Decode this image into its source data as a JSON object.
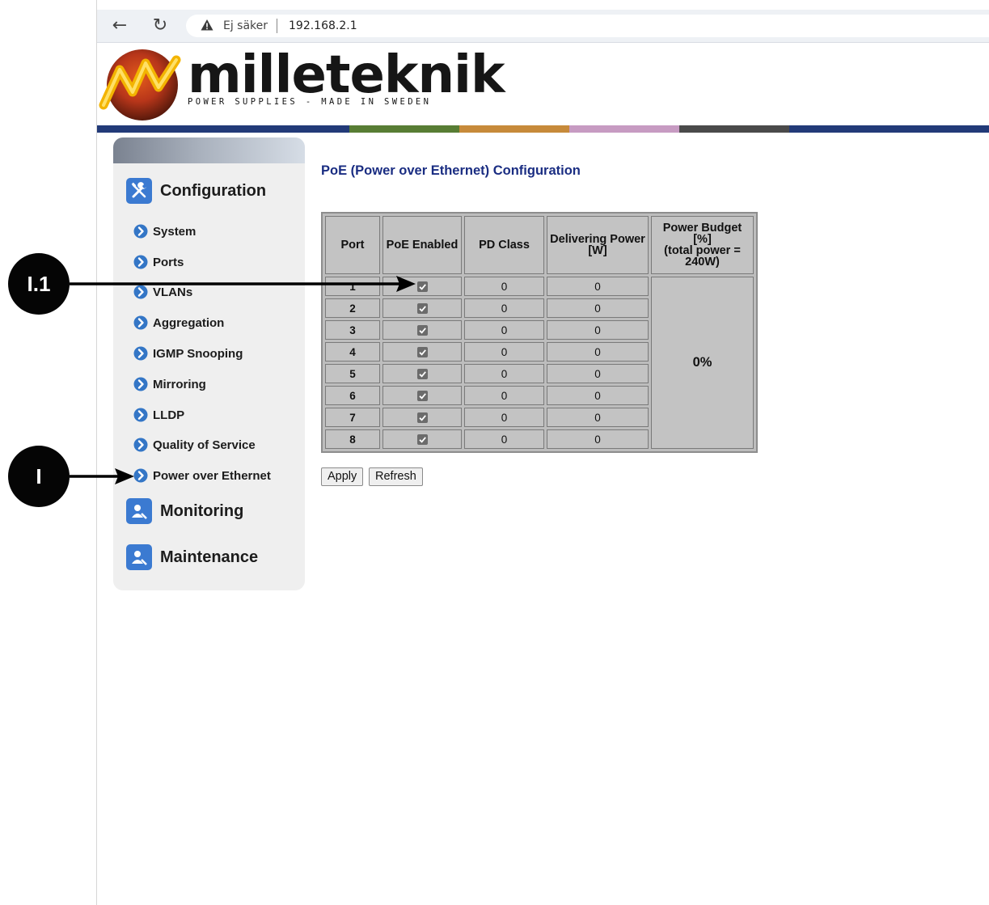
{
  "browser": {
    "security_label": "Ej säker",
    "url": "192.168.2.1"
  },
  "logo": {
    "wordmark": "milleteknik",
    "tagline": "POWER SUPPLIES - MADE IN SWEDEN"
  },
  "colors": {
    "strip": [
      "#223a78",
      "#587d34",
      "#c78a3a",
      "#c79bc2",
      "#4a4a4a",
      "#223a78"
    ],
    "title": "#1a2d82",
    "icon_blue": "#3b7ad1"
  },
  "sidebar": {
    "configuration": "Configuration",
    "items": [
      {
        "label": "System",
        "icon": "chevron-right-icon"
      },
      {
        "label": "Ports",
        "icon": "chevron-right-icon"
      },
      {
        "label": "VLANs",
        "icon": "chevron-right-icon"
      },
      {
        "label": "Aggregation",
        "icon": "chevron-right-icon"
      },
      {
        "label": "IGMP Snooping",
        "icon": "chevron-right-icon"
      },
      {
        "label": "Mirroring",
        "icon": "chevron-right-icon"
      },
      {
        "label": "LLDP",
        "icon": "chevron-right-icon"
      },
      {
        "label": "Quality of Service",
        "icon": "chevron-right-icon"
      },
      {
        "label": "Power over Ethernet",
        "icon": "chevron-right-icon"
      }
    ],
    "monitoring": "Monitoring",
    "maintenance": "Maintenance"
  },
  "main": {
    "title": "PoE (Power over Ethernet) Configuration",
    "headers": {
      "port": "Port",
      "poe_enabled": "PoE Enabled",
      "pd_class": "PD Class",
      "delivering_1": "Delivering Power",
      "delivering_2": "[W]",
      "budget_1": "Power Budget",
      "budget_2": "[%]",
      "budget_3": "(total power =",
      "budget_4": "240W)"
    },
    "rows": [
      {
        "port": "1",
        "enabled": true,
        "pd_class": "0",
        "power": "0"
      },
      {
        "port": "2",
        "enabled": true,
        "pd_class": "0",
        "power": "0"
      },
      {
        "port": "3",
        "enabled": true,
        "pd_class": "0",
        "power": "0"
      },
      {
        "port": "4",
        "enabled": true,
        "pd_class": "0",
        "power": "0"
      },
      {
        "port": "5",
        "enabled": true,
        "pd_class": "0",
        "power": "0"
      },
      {
        "port": "6",
        "enabled": true,
        "pd_class": "0",
        "power": "0"
      },
      {
        "port": "7",
        "enabled": true,
        "pd_class": "0",
        "power": "0"
      },
      {
        "port": "8",
        "enabled": true,
        "pd_class": "0",
        "power": "0"
      }
    ],
    "budget_value": "0%",
    "apply_label": "Apply",
    "refresh_label": "Refresh"
  },
  "annotations": {
    "badge_top": "I.1",
    "badge_bottom": "I"
  }
}
